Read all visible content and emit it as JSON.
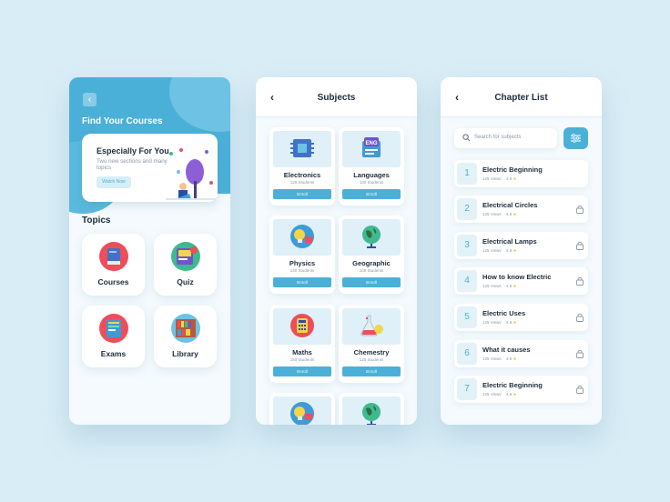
{
  "screen1": {
    "title": "Find Your Courses",
    "promo": {
      "title": "Especially For You",
      "subtitle": "Two new sections and many topics",
      "button": "Watch Now"
    },
    "topics_title": "Topics",
    "topics": [
      {
        "label": "Courses",
        "icon": "book-icon"
      },
      {
        "label": "Quiz",
        "icon": "quiz-board-icon"
      },
      {
        "label": "Exams",
        "icon": "exam-book-icon"
      },
      {
        "label": "Library",
        "icon": "bookshelf-icon"
      }
    ]
  },
  "screen2": {
    "title": "Subjects",
    "subjects": [
      {
        "name": "Electronics",
        "students": "125 Students",
        "enroll": "Enroll",
        "icon": "chip-icon"
      },
      {
        "name": "Languages",
        "students": "120 Students",
        "enroll": "Enroll",
        "icon": "eng-book-icon"
      },
      {
        "name": "Physics",
        "students": "140 Students",
        "enroll": "Enroll",
        "icon": "lightbulb-icon"
      },
      {
        "name": "Geographic",
        "students": "100 Students",
        "enroll": "Enroll",
        "icon": "globe-icon"
      },
      {
        "name": "Maths",
        "students": "150 Students",
        "enroll": "Enroll",
        "icon": "calculator-icon"
      },
      {
        "name": "Chemestry",
        "students": "125 Students",
        "enroll": "Enroll",
        "icon": "flask-icon"
      }
    ]
  },
  "screen3": {
    "title": "Chapter List",
    "search_placeholder": "Search for subjects",
    "chapters": [
      {
        "num": "1",
        "title": "Electric Beginning",
        "views": "125 Views",
        "rating": "4.9",
        "locked": false
      },
      {
        "num": "2",
        "title": "Electrical Circles",
        "views": "125 Views",
        "rating": "4.9",
        "locked": true
      },
      {
        "num": "3",
        "title": "Electrical Lamps",
        "views": "125 Views",
        "rating": "4.9",
        "locked": true
      },
      {
        "num": "4",
        "title": "How to know Electric",
        "views": "125 Views",
        "rating": "4.9",
        "locked": true
      },
      {
        "num": "5",
        "title": "Electric Uses",
        "views": "125 Views",
        "rating": "4.9",
        "locked": true
      },
      {
        "num": "6",
        "title": "What it causes",
        "views": "125 Views",
        "rating": "4.9",
        "locked": true
      },
      {
        "num": "7",
        "title": "Electric Beginning",
        "views": "125 Views",
        "rating": "4.9",
        "locked": true
      }
    ]
  },
  "colors": {
    "accent": "#4bb0d8",
    "background": "#d9edf6",
    "card": "#ffffff",
    "star": "#f5b630"
  }
}
